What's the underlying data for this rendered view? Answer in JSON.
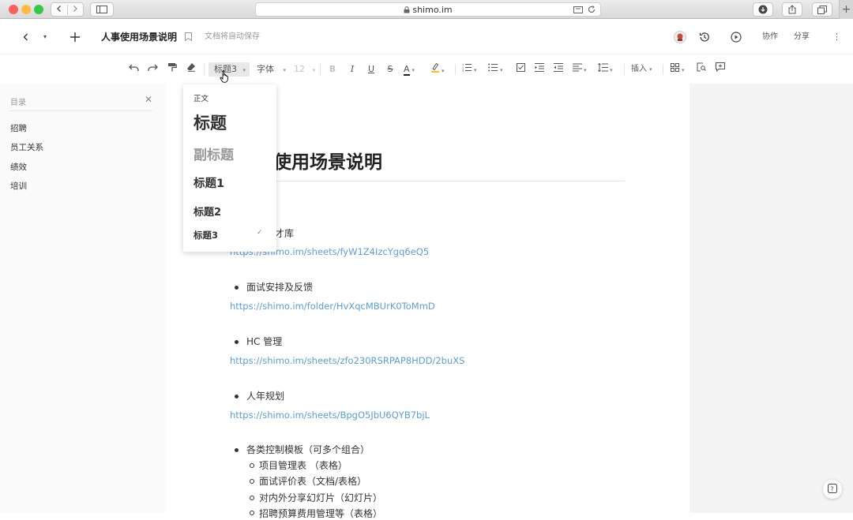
{
  "browser": {
    "url": "shimo.im",
    "lock_icon": "lock-icon"
  },
  "header": {
    "doc_title": "人事使用场景说明",
    "autosave": "文档将自动保存",
    "collab": "协作",
    "share": "分享"
  },
  "toolbar": {
    "heading_select": "标题3",
    "font_select": "字体",
    "size_select": "12",
    "insert": "插入"
  },
  "heading_menu": {
    "items": [
      {
        "label": "正文"
      },
      {
        "label": "标题"
      },
      {
        "label": "副标题"
      },
      {
        "label": "标题1"
      },
      {
        "label": "标题2"
      },
      {
        "label": "标题3"
      }
    ],
    "selected": "标题3"
  },
  "sidebar": {
    "title": "目录",
    "items": [
      {
        "label": "招聘"
      },
      {
        "label": "员工关系"
      },
      {
        "label": "绩效"
      },
      {
        "label": "培训"
      }
    ]
  },
  "document": {
    "title_visible": "使用场景说明",
    "items": [
      {
        "text": "才库",
        "link": "https://shimo.im/sheets/fyW1Z4IzcYgq6eQ5"
      },
      {
        "text": "面试安排及反馈",
        "link": "https://shimo.im/folder/HvXqcMBUrK0ToMmD"
      },
      {
        "text": "HC 管理",
        "link": "https://shimo.im/sheets/zfo230RSRPAP8HDD/2buXS"
      },
      {
        "text": "人年规划",
        "link": "https://shimo.im/sheets/BpgO5JbU6QYB7bjL"
      }
    ],
    "templates": {
      "text": "各类控制模板（可多个组合）",
      "sub": [
        {
          "text": "项目管理表 （表格）"
        },
        {
          "text": "面试评价表（文档/表格）"
        },
        {
          "text": "对内外分享幻灯片（幻灯片）"
        },
        {
          "text": "招聘预算费用管理等（表格）"
        }
      ]
    }
  }
}
